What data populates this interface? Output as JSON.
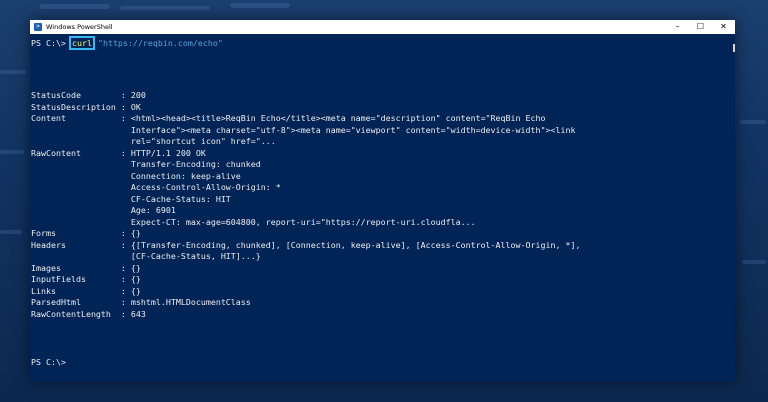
{
  "window": {
    "title": "Windows PowerShell",
    "minimize_glyph": "–",
    "maximize_glyph": "☐",
    "close_glyph": "✕",
    "icon": "powershell-icon"
  },
  "terminal": {
    "prompt": "PS C:\\> ",
    "command": "curl",
    "argument": "\"https://reqbin.com/echo\"",
    "output_lines": [
      "StatusCode        : 200",
      "StatusDescription : OK",
      "Content           : <html><head><title>ReqBin Echo</title><meta name=\"description\" content=\"ReqBin Echo",
      "                    Interface\"><meta charset=\"utf-8\"><meta name=\"viewport\" content=\"width=device-width\"><link",
      "                    rel=\"shortcut icon\" href=\"...",
      "RawContent        : HTTP/1.1 200 OK",
      "                    Transfer-Encoding: chunked",
      "                    Connection: keep-alive",
      "                    Access-Control-Allow-Origin: *",
      "                    CF-Cache-Status: HIT",
      "                    Age: 6901",
      "                    Expect-CT: max-age=604800, report-uri=\"https://report-uri.cloudfla...",
      "Forms             : {}",
      "Headers           : {[Transfer-Encoding, chunked], [Connection, keep-alive], [Access-Control-Allow-Origin, *],",
      "                    [CF-Cache-Status, HIT]...}",
      "Images            : {}",
      "InputFields       : {}",
      "Links             : {}",
      "ParsedHtml        : mshtml.HTMLDocumentClass",
      "RawContentLength  : 643"
    ],
    "final_prompt": "PS C:\\>"
  },
  "colors": {
    "console_bg": "#012456",
    "console_fg": "#eeedf0",
    "command_fg": "#fcfc54",
    "string_fg": "#5ea1da",
    "highlight_box": "#38b7f5"
  }
}
